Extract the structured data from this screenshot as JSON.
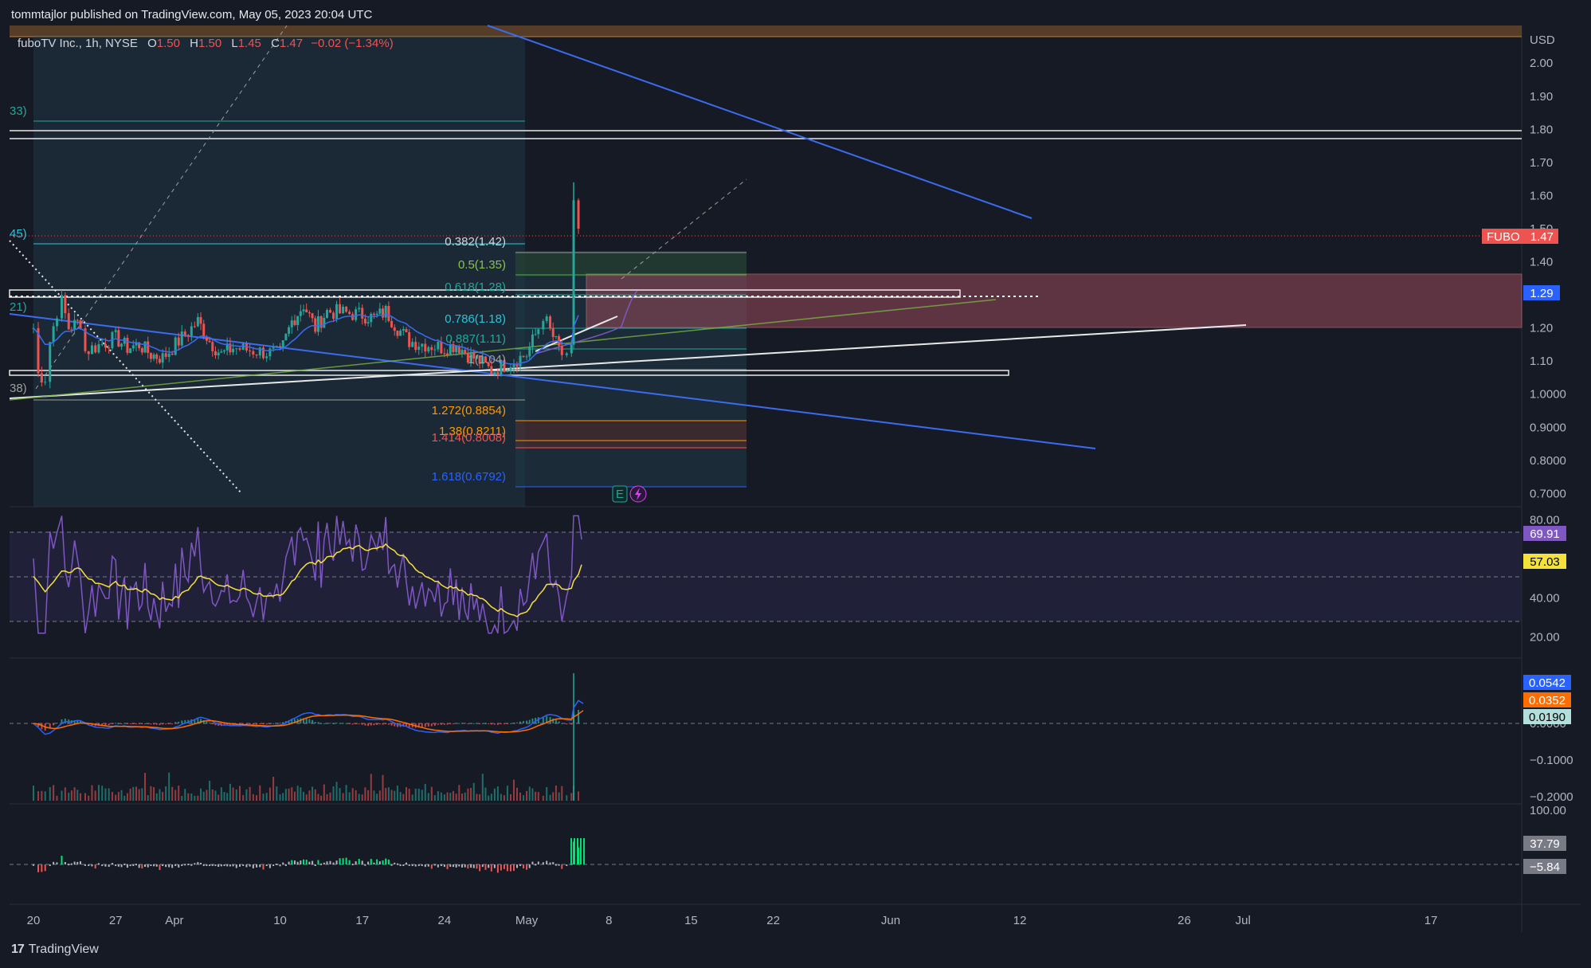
{
  "header": {
    "publisher_line": "tommtajlor published on TradingView.com, May 05, 2023 20:04 UTC"
  },
  "legend": {
    "name": "fuboTV Inc., 1h, NYSE",
    "o_label": "O",
    "o_value": "1.50",
    "h_label": "H",
    "h_value": "1.50",
    "l_label": "L",
    "l_value": "1.45",
    "c_label": "C",
    "c_value": "1.47",
    "change": "−0.02 (−1.34%)"
  },
  "colors": {
    "background": "#161a25",
    "up": "#26a69a",
    "down": "#ef5350",
    "rsi": "#7e57c2",
    "rsi_ma": "#f5e13b",
    "macd": "#2962ff",
    "signal": "#ff6d00",
    "trend_blue": "#3b6cf0"
  },
  "price_axis": {
    "currency": "USD",
    "ticks": [
      "2.00",
      "1.90",
      "1.80",
      "1.70",
      "1.60",
      "1.50",
      "1.40",
      "1.30",
      "1.20",
      "1.10",
      "1.0000",
      "0.9000",
      "0.8000",
      "0.7000"
    ]
  },
  "rsi_axis": {
    "ticks": [
      "80.00",
      "60.00",
      "40.00",
      "20.00"
    ]
  },
  "macd_axis": {
    "ticks": [
      "0.0000",
      "−0.1000",
      "−0.2000"
    ]
  },
  "osc_axis": {
    "ticks": [
      "100.00"
    ]
  },
  "time_axis": {
    "ticks": [
      "20",
      "27",
      "Apr",
      "10",
      "17",
      "24",
      "May",
      "8",
      "15",
      "22",
      "Jun",
      "12",
      "26",
      "Jul",
      "17"
    ]
  },
  "badges": {
    "symbol": "FUBO",
    "last_price": "1.47",
    "level": "1.29",
    "rsi": "69.91",
    "rsi_ma": "57.03",
    "macd": "0.0542",
    "signal": "0.0352",
    "hist": "0.0190",
    "osc1": "37.79",
    "osc2": "−5.84"
  },
  "fib_labels": {
    "f382": "0.382(1.42)",
    "f5": "0.5(1.35)",
    "f618": "0.618(1.28)",
    "f786": "0.786(1.18)",
    "f887": "0.887(1.11)",
    "f1": "1(1.04)",
    "f1272": "1.272(0.8854)",
    "f138": "1.38(0.8211)",
    "f1414": "1.414(0.8008)",
    "f1618": "1.618(0.6792)",
    "left1": "33)",
    "left2": "45)",
    "left3": "21)",
    "left4": "38)"
  },
  "markers": {
    "earnings": "E"
  },
  "branding": {
    "logo_text": "TradingView"
  },
  "chart_data": {
    "type": "candlestick",
    "title": "fuboTV Inc., 1h, NYSE",
    "y_range": [
      0.66,
      2.08
    ],
    "x_range": [
      "2023-03-20",
      "2023-07-21"
    ],
    "ohlc_summary": {
      "open": 1.5,
      "high": 1.5,
      "low": 1.45,
      "close": 1.47,
      "change": -0.02,
      "change_pct": -1.34
    },
    "close_path": [
      [
        "2023-03-20",
        1.2
      ],
      [
        "2023-03-20",
        1.06
      ],
      [
        "2023-03-21",
        1.05
      ],
      [
        "2023-03-21",
        1.16
      ],
      [
        "2023-03-22",
        1.25
      ],
      [
        "2023-03-22",
        1.28
      ],
      [
        "2023-03-23",
        1.2
      ],
      [
        "2023-03-24",
        1.22
      ],
      [
        "2023-03-24",
        1.13
      ],
      [
        "2023-03-27",
        1.17
      ],
      [
        "2023-03-28",
        1.14
      ],
      [
        "2023-03-29",
        1.15
      ],
      [
        "2023-03-30",
        1.12
      ],
      [
        "2023-03-31",
        1.11
      ],
      [
        "2023-04-03",
        1.22
      ],
      [
        "2023-04-04",
        1.16
      ],
      [
        "2023-04-05",
        1.12
      ],
      [
        "2023-04-06",
        1.14
      ],
      [
        "2023-04-10",
        1.12
      ],
      [
        "2023-04-11",
        1.22
      ],
      [
        "2023-04-12",
        1.27
      ],
      [
        "2023-04-13",
        1.2
      ],
      [
        "2023-04-14",
        1.25
      ],
      [
        "2023-04-17",
        1.24
      ],
      [
        "2023-04-18",
        1.23
      ],
      [
        "2023-04-19",
        1.25
      ],
      [
        "2023-04-20",
        1.2
      ],
      [
        "2023-04-21",
        1.16
      ],
      [
        "2023-04-24",
        1.14
      ],
      [
        "2023-04-25",
        1.15
      ],
      [
        "2023-04-26",
        1.12
      ],
      [
        "2023-04-27",
        1.1
      ],
      [
        "2023-04-28",
        1.07
      ],
      [
        "2023-05-01",
        1.12
      ],
      [
        "2023-05-02",
        1.2
      ],
      [
        "2023-05-02",
        1.24
      ],
      [
        "2023-05-03",
        1.19
      ],
      [
        "2023-05-04",
        1.12
      ],
      [
        "2023-05-04",
        1.1
      ],
      [
        "2023-05-04",
        1.13
      ],
      [
        "2023-05-05",
        1.59
      ],
      [
        "2023-05-05",
        1.5
      ],
      [
        "2023-05-05",
        1.47
      ]
    ],
    "horizontal_levels": [
      1.8,
      1.78,
      1.29,
      1.04
    ],
    "zone": {
      "from": 1.35,
      "to": 1.18
    },
    "fibonacci": [
      {
        "ratio": 0.382,
        "price": 1.42
      },
      {
        "ratio": 0.5,
        "price": 1.35
      },
      {
        "ratio": 0.618,
        "price": 1.28
      },
      {
        "ratio": 0.786,
        "price": 1.18
      },
      {
        "ratio": 0.887,
        "price": 1.11
      },
      {
        "ratio": 1,
        "price": 1.04
      },
      {
        "ratio": 1.272,
        "price": 0.8854
      },
      {
        "ratio": 1.38,
        "price": 0.8211
      },
      {
        "ratio": 1.414,
        "price": 0.8008
      },
      {
        "ratio": 1.618,
        "price": 0.6792
      }
    ],
    "rsi": {
      "range": [
        20,
        80
      ],
      "bands": [
        70,
        50,
        30
      ],
      "last": 69.91,
      "ma_last": 57.03
    },
    "macd": {
      "macd": 0.0542,
      "signal": 0.0352,
      "hist": 0.019
    },
    "oscillator": {
      "values": [
        37.79,
        -5.84
      ]
    },
    "grid": true
  }
}
